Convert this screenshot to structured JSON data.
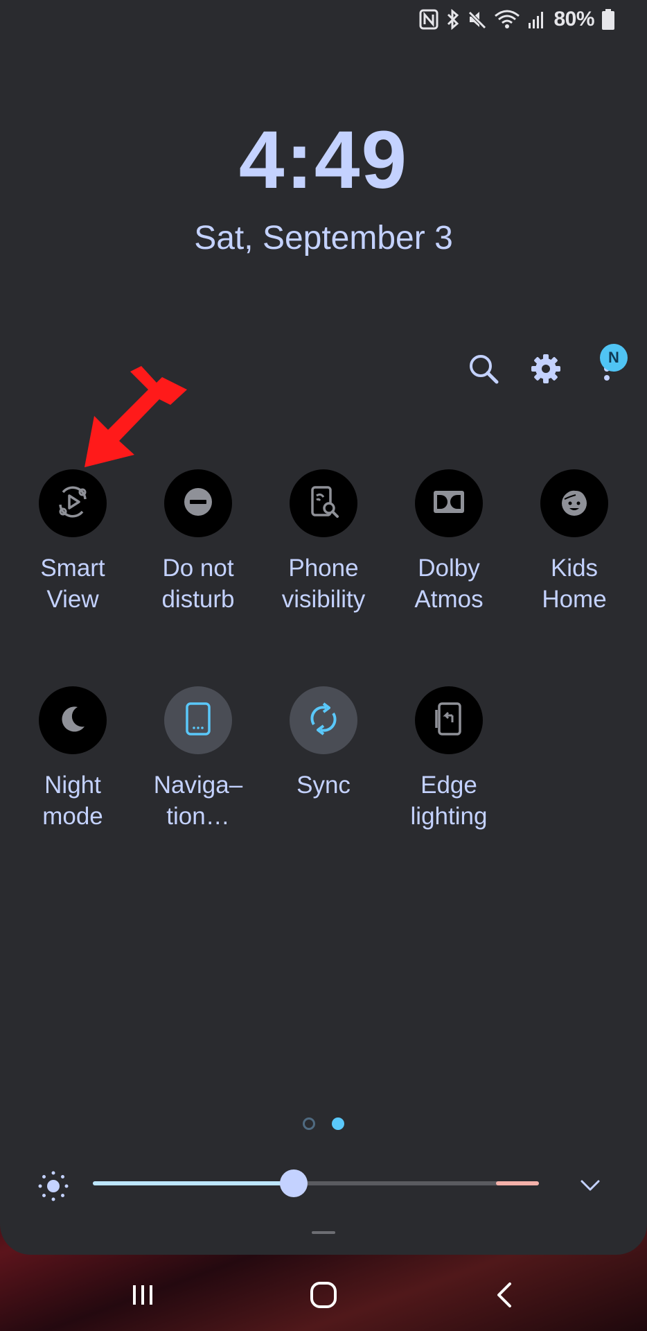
{
  "status_bar": {
    "icons": [
      "nfc-icon",
      "bluetooth-icon",
      "mute-icon",
      "wifi-icon",
      "signal-icon",
      "battery-icon"
    ],
    "battery_percent": "80%"
  },
  "clock": {
    "time": "4:49",
    "date": "Sat, September 3"
  },
  "header_actions": {
    "search_icon": "search-icon",
    "settings_icon": "gear-icon",
    "more_icon": "more-vert-icon",
    "notification_badge": "N"
  },
  "tiles": [
    {
      "icon": "smart-view-icon",
      "line1": "Smart",
      "line2": "View",
      "active": false
    },
    {
      "icon": "do-not-disturb-icon",
      "line1": "Do not",
      "line2": "disturb",
      "active": false
    },
    {
      "icon": "phone-visibility-icon",
      "line1": "Phone",
      "line2": "visibility",
      "active": false
    },
    {
      "icon": "dolby-icon",
      "line1": "Dolby",
      "line2": "Atmos",
      "active": false
    },
    {
      "icon": "kids-home-icon",
      "line1": "Kids",
      "line2": "Home",
      "active": false
    },
    {
      "icon": "night-mode-icon",
      "line1": "Night",
      "line2": "mode",
      "active": false
    },
    {
      "icon": "navigation-bar-icon",
      "line1": "Naviga–",
      "line2": "tion…",
      "active": true
    },
    {
      "icon": "sync-icon",
      "line1": "Sync",
      "line2": "",
      "active": true
    },
    {
      "icon": "edge-lighting-icon",
      "line1": "Edge",
      "line2": "lighting",
      "active": false
    }
  ],
  "pager": {
    "pages": 2,
    "current": 2
  },
  "brightness": {
    "level": 0.45,
    "icon": "brightness-icon"
  },
  "colors": {
    "panel": "#2a2b2f",
    "accent": "#c4d2ff",
    "active_blue": "#5ac8fa",
    "annotation_red": "#ff1a1a"
  },
  "navbar": {
    "icons": [
      "recent-apps-icon",
      "home-icon",
      "back-icon"
    ]
  }
}
